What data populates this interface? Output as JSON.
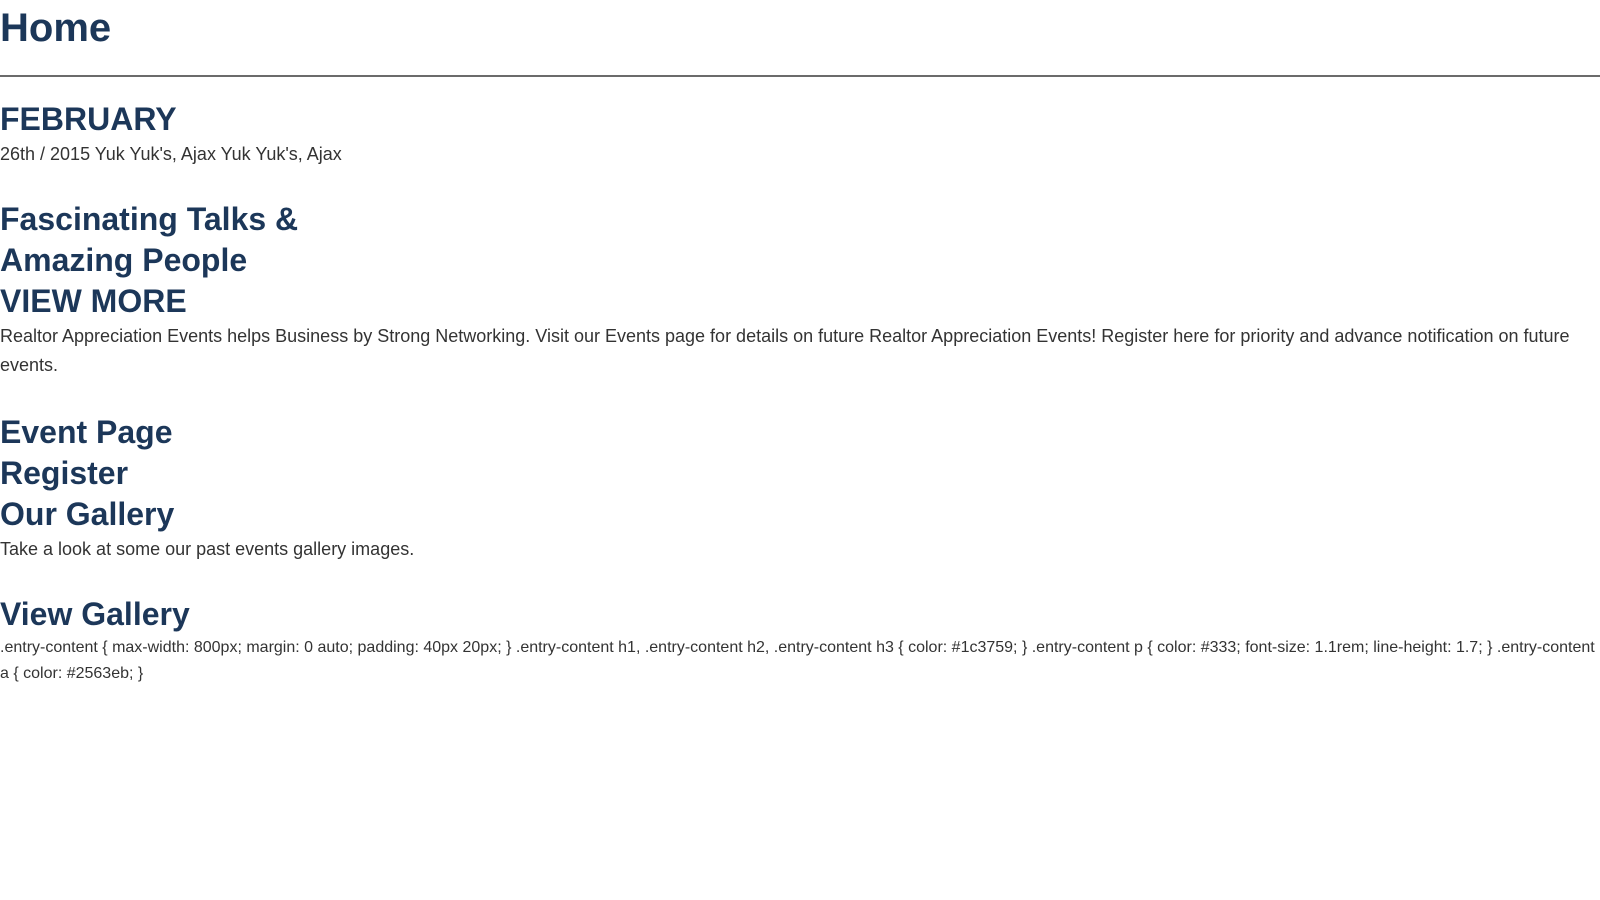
{
  "header": {
    "title": "Home"
  },
  "event": {
    "month": "FEBRUARY",
    "date_location": "26th / 2015 Yuk Yuk's, Ajax Yuk Yuk's, Ajax"
  },
  "feature": {
    "heading_line1": "Fascinating Talks &",
    "heading_line2": "Amazing People",
    "view_more": "VIEW MORE",
    "description": "Realtor Appreciation Events helps Business by Strong Networking. Visit our Events page for details on future Realtor Appreciation Events! Register here for priority and advance notification on future events."
  },
  "links": {
    "event_page": "Event Page",
    "register": "Register",
    "our_gallery": "Our Gallery"
  },
  "gallery": {
    "description": "Take a look at some our past events gallery images.",
    "view_gallery": "View Gallery"
  },
  "footer": {
    "css_text": ".entry-content { max-width: 800px; margin: 0 auto; padding: 40px 20px; } .entry-content h1, .entry-content h2, .entry-content h3 { color: #1c3759; } .entry-content p { color: #333; font-size: 1.1rem; line-height: 1.7; } .entry-content a { color: #2563eb; }"
  },
  "colors": {
    "heading": "#1c3759",
    "text": "#333333",
    "divider": "#6b6b6b"
  }
}
